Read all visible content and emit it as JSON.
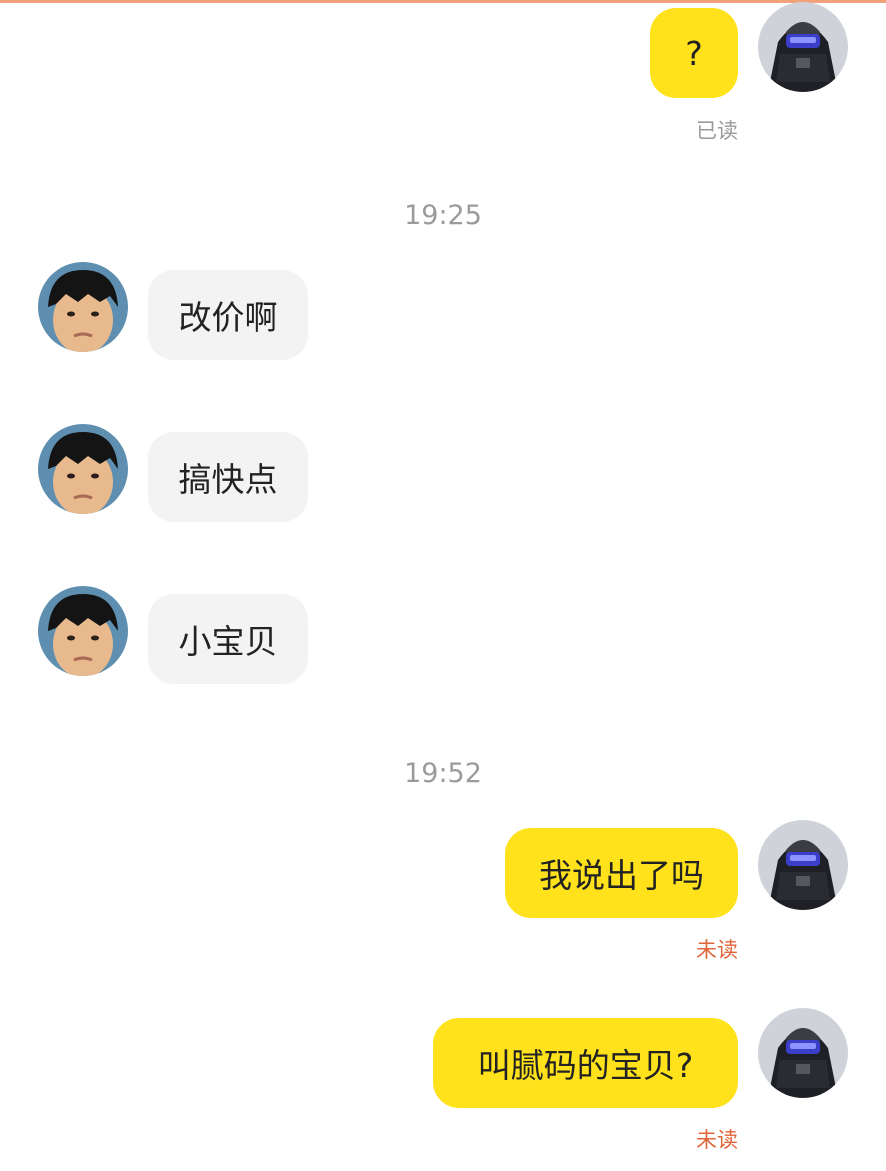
{
  "colors": {
    "my_bubble": "#ffe21c",
    "their_bubble": "#f3f3f3",
    "read_status": "#9a9a9a",
    "unread_status": "#e0663a",
    "timestamp": "#9b9b9b"
  },
  "messages_top": {
    "question": {
      "text": "?",
      "status": "已读"
    }
  },
  "timestamps": [
    "19:25",
    "19:52"
  ],
  "incoming": [
    {
      "text": "改价啊"
    },
    {
      "text": "搞快点"
    },
    {
      "text": "小宝贝"
    }
  ],
  "outgoing": [
    {
      "text": "我说出了吗",
      "status": "未读"
    },
    {
      "text": "叫腻码的宝贝?",
      "status": "未读"
    }
  ]
}
